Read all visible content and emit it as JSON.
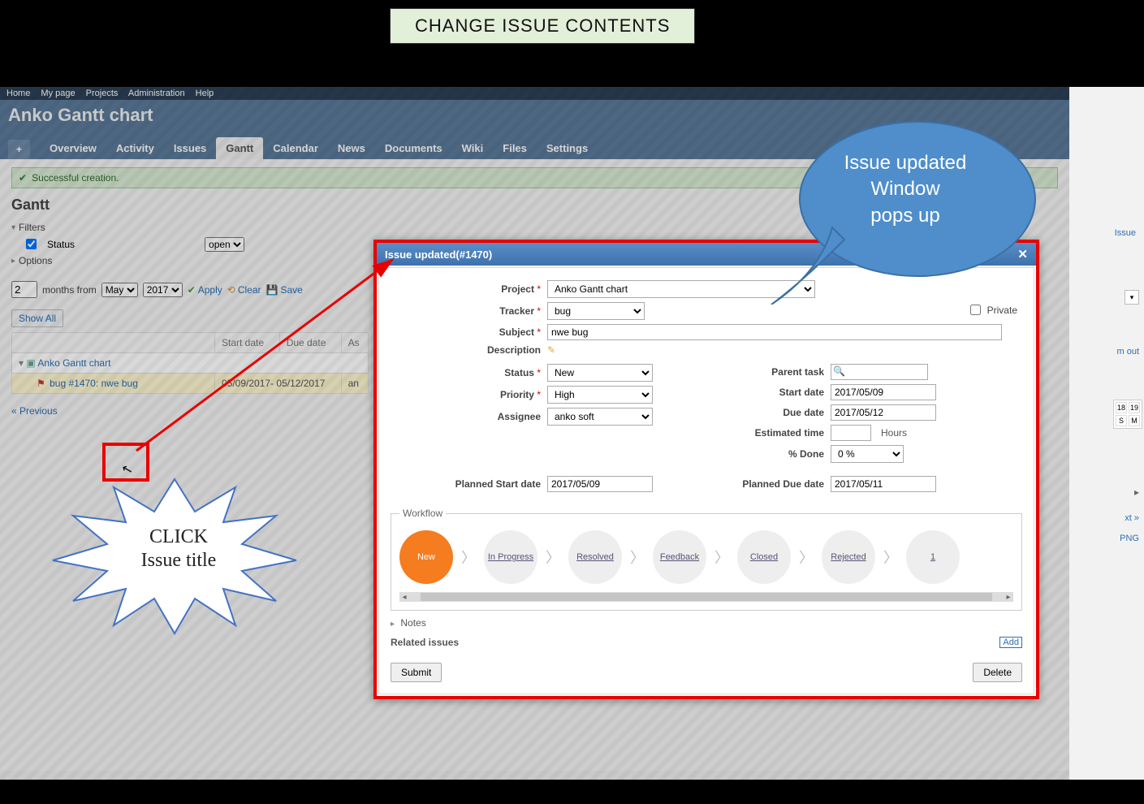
{
  "annotations": {
    "banner": "CHANGE ISSUE CONTENTS",
    "starburst_line1": "CLICK",
    "starburst_line2": "Issue title",
    "speech_line1": "Issue updated",
    "speech_line2": "Window",
    "speech_line3": "pops up"
  },
  "topmenu": {
    "home": "Home",
    "mypage": "My page",
    "projects": "Projects",
    "admin": "Administration",
    "help": "Help"
  },
  "header": {
    "title": "Anko Gantt chart"
  },
  "tabs": {
    "plus": "+",
    "overview": "Overview",
    "activity": "Activity",
    "issues": "Issues",
    "gantt": "Gantt",
    "calendar": "Calendar",
    "news": "News",
    "documents": "Documents",
    "wiki": "Wiki",
    "files": "Files",
    "settings": "Settings"
  },
  "flash": {
    "text": "Successful creation."
  },
  "page_title": "Gantt",
  "sidecontrols": {
    "filters": "Filters",
    "status": "Status",
    "status_select": "open",
    "options": "Options"
  },
  "toolbar": {
    "months_count": "2",
    "months_from": "months from",
    "month": "May",
    "year": "2017",
    "apply": "Apply",
    "clear": "Clear",
    "save": "Save"
  },
  "table": {
    "showall": "Show All",
    "headers": {
      "start": "Start date",
      "due": "Due date",
      "assignee": "As"
    },
    "project_name": "Anko Gantt chart",
    "issue": {
      "label": "bug #1470: nwe bug",
      "dates": "05/09/2017- 05/12/2017",
      "assignee": "an"
    }
  },
  "pager": {
    "prev": "« Previous"
  },
  "rightstrip": {
    "new_issue": "Issue",
    "zoom": "m out",
    "cal1": "18",
    "cal2": "19",
    "cal3": "S",
    "cal4": "M",
    "next": "xt »",
    "png": "PNG"
  },
  "modal": {
    "title": "Issue updated(#1470)",
    "labels": {
      "project": "Project",
      "tracker": "Tracker",
      "subject": "Subject",
      "description": "Description",
      "status": "Status",
      "priority": "Priority",
      "assignee": "Assignee",
      "parent": "Parent task",
      "start": "Start date",
      "due": "Due date",
      "est": "Estimated time",
      "est_unit": "Hours",
      "done": "% Done",
      "pstart": "Planned Start date",
      "pdue": "Planned Due date",
      "private": "Private"
    },
    "values": {
      "project": "Anko Gantt chart",
      "tracker": "bug",
      "subject": "nwe bug",
      "status": "New",
      "priority": "High",
      "assignee": "anko soft",
      "start": "2017/05/09",
      "due": "2017/05/12",
      "est": "",
      "done": "0 %",
      "pstart": "2017/05/09",
      "pdue": "2017/05/11"
    },
    "workflow": {
      "legend": "Workflow",
      "steps": [
        "New",
        "In Progress",
        "Resolved",
        "Feedback",
        "Closed",
        "Rejected",
        "1"
      ]
    },
    "notes_label": "Notes",
    "related_label": "Related issues",
    "add": "Add",
    "submit": "Submit",
    "delete": "Delete"
  }
}
